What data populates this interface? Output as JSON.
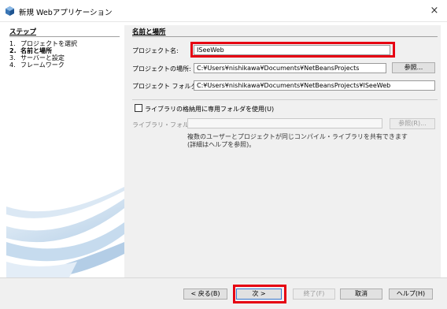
{
  "window": {
    "title": "新規 Webアプリケーション",
    "close_glyph": "×"
  },
  "steps": {
    "heading": "ステップ",
    "items": [
      {
        "num": "1.",
        "label": "プロジェクトを選択",
        "active": false
      },
      {
        "num": "2.",
        "label": "名前と場所",
        "active": true
      },
      {
        "num": "3.",
        "label": "サーバーと設定",
        "active": false
      },
      {
        "num": "4.",
        "label": "フレームワーク",
        "active": false
      }
    ]
  },
  "form": {
    "heading": "名前と場所",
    "project_name_label": "プロジェクト名:",
    "project_name_value": "ISeeWeb",
    "project_location_label": "プロジェクトの場所:",
    "project_location_value": "C:¥Users¥nishikawa¥Documents¥NetBeansProjects",
    "browse_label": "参照...",
    "project_folder_label": "プロジェクト フォルダ:",
    "project_folder_value": "C:¥Users¥nishikawa¥Documents¥NetBeansProjects¥ISeeWeb",
    "library_checkbox_label": "ライブラリの格納用に専用フォルダを使用(U)",
    "library_checkbox_checked": false,
    "library_folder_label": "ライブラリ・フォルダ:",
    "library_folder_value": "",
    "browse_disabled_label": "参照(R)...",
    "hint_line1": "複数のユーザーとプロジェクトが同じコンパイル・ライブラリを共有できます",
    "hint_line2": "(詳細はヘルプを参照)。"
  },
  "buttons": {
    "back": "< 戻る(B)",
    "next": "次 >",
    "finish": "終了(F)",
    "cancel": "取消",
    "help": "ヘルプ(H)"
  },
  "colors": {
    "highlight": "#e60012",
    "panel_bg": "#f0f0f0",
    "graphic_blue": "#cfe0ef"
  },
  "icons": {
    "app": "netbeans-cube-icon",
    "close": "close-icon"
  }
}
